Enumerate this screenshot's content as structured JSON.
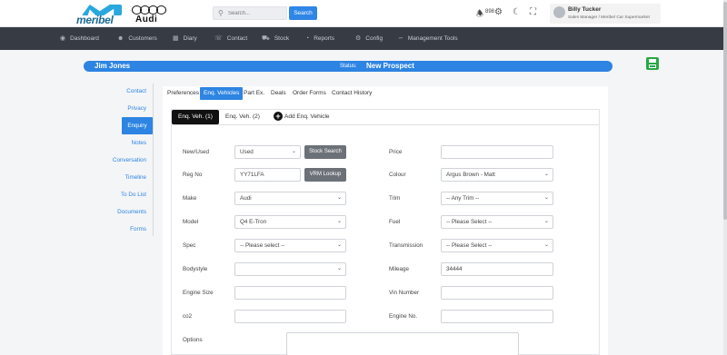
{
  "brand": {
    "meribel": "meribel",
    "audi": "Audi"
  },
  "search": {
    "placeholder": "Search...",
    "button": "Search"
  },
  "notifications": {
    "count": "898"
  },
  "user": {
    "name": "Billy Tucker",
    "role": "Sales Manager / Meribel Car Supermarket"
  },
  "nav": [
    {
      "label": "Dashboard",
      "icon": "dashboard-icon"
    },
    {
      "label": "Customers",
      "icon": "customers-icon"
    },
    {
      "label": "Diary",
      "icon": "calendar-icon"
    },
    {
      "label": "Contact",
      "icon": "contact-icon"
    },
    {
      "label": "Stock",
      "icon": "car-icon"
    },
    {
      "label": "Reports",
      "icon": "chart-icon"
    },
    {
      "label": "Config",
      "icon": "gear-icon"
    },
    {
      "label": "Management Tools",
      "icon": "chart-line-icon"
    }
  ],
  "customer": {
    "name": "Jim Jones",
    "status_label": "Status:",
    "status": "New Prospect"
  },
  "side_nav": [
    "Contact",
    "Privacy",
    "Enquiry",
    "Notes",
    "Conversation",
    "Timeline",
    "To Do List",
    "Documents",
    "Forms"
  ],
  "tabs": [
    "Preferences",
    "Enq. Vehicles",
    "Part Ex.",
    "Deals",
    "Order Forms",
    "Contact History"
  ],
  "vehicle_tabs": {
    "active": "Enq. Veh. (1)",
    "second": "Enq. Veh. (2)",
    "add": "Add Enq. Vehicle"
  },
  "form": {
    "left": [
      {
        "label": "New/Used",
        "value": "Used",
        "button": "Stock Search"
      },
      {
        "label": "Reg No",
        "value": "YY71LFA",
        "button": "VRM Lookup"
      },
      {
        "label": "Make",
        "value": "Audi"
      },
      {
        "label": "Model",
        "value": "Q4 E-Tron"
      },
      {
        "label": "Spec",
        "value": "-- Please select --"
      },
      {
        "label": "Bodystyle",
        "value": ""
      },
      {
        "label": "Engine Size",
        "value": ""
      },
      {
        "label": "co2",
        "value": ""
      }
    ],
    "right": [
      {
        "label": "Price",
        "value": ""
      },
      {
        "label": "Colour",
        "value": "Argus Brown - Matt"
      },
      {
        "label": "Trim",
        "value": "-- Any Trim --"
      },
      {
        "label": "Fuel",
        "value": "-- Please Select --"
      },
      {
        "label": "Transmission",
        "value": "-- Please Select --"
      },
      {
        "label": "Mileage",
        "value": "34444"
      },
      {
        "label": "Vin Number",
        "value": ""
      },
      {
        "label": "Engine No.",
        "value": ""
      }
    ],
    "options_label": "Options"
  },
  "colors": {
    "primary": "#2d84e2",
    "navbar": "#363b44",
    "save": "#28a745"
  }
}
